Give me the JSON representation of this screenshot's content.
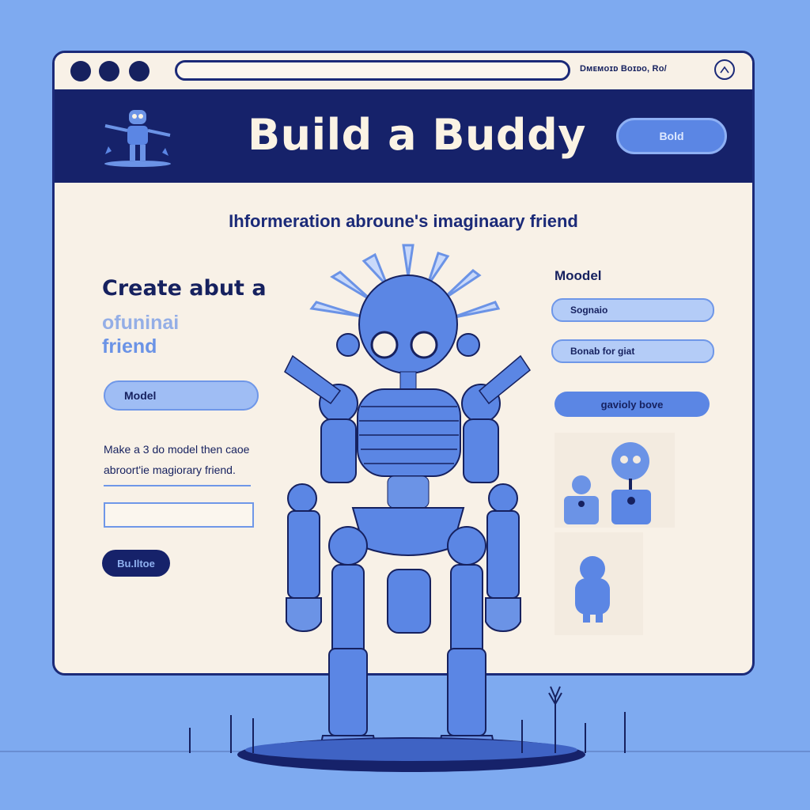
{
  "window": {
    "title_links": "Dᴍᴇᴍᴏɪᴅ Bᴏɪᴅᴏ, Rᴏ/",
    "menu_icon": "chevron-up-icon"
  },
  "banner": {
    "title": "Build a Buddy",
    "button_label": "Bold",
    "logo_icon": "robot-icon"
  },
  "main": {
    "subtitle": "Ihformeration abroune's imaginaary friend",
    "left": {
      "heading": "Create abut a",
      "sub_line1": "ofuninai",
      "sub_line2": "friend",
      "model_input": "Model",
      "description": "Make a 3 do model then caoe abroort'ie magiorary friend.",
      "submit_label": "Bu.Iltoe"
    },
    "right": {
      "label": "Moodel",
      "input1": "Sognaio",
      "input2": "Bonab for giat",
      "button_label": "gavioly bove"
    }
  },
  "colors": {
    "background": "#7eaaf0",
    "navy": "#16226a",
    "cream": "#f8f1e7",
    "accent": "#5b86e4"
  }
}
